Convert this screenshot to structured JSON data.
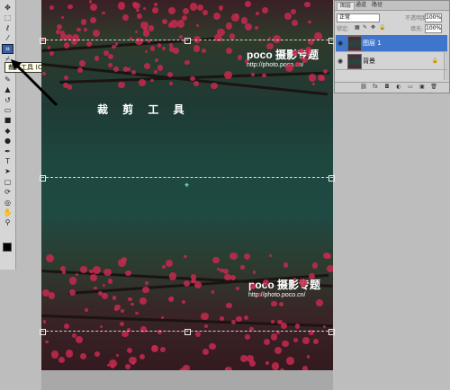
{
  "toolbox": {
    "tools": [
      {
        "icon": "move-tool-icon",
        "glyph": "✥"
      },
      {
        "icon": "marquee-tool-icon",
        "glyph": "⬚"
      },
      {
        "icon": "lasso-tool-icon",
        "glyph": "ℓ"
      },
      {
        "icon": "magic-wand-tool-icon",
        "glyph": "⁄"
      },
      {
        "icon": "crop-tool-icon",
        "glyph": "⌗"
      },
      {
        "icon": "slice-tool-icon",
        "glyph": "⌿"
      },
      {
        "icon": "healing-brush-icon",
        "glyph": "✚"
      },
      {
        "icon": "brush-tool-icon",
        "glyph": "✎"
      },
      {
        "icon": "stamp-tool-icon",
        "glyph": "▲"
      },
      {
        "icon": "history-brush-icon",
        "glyph": "↺"
      },
      {
        "icon": "eraser-tool-icon",
        "glyph": "▭"
      },
      {
        "icon": "gradient-tool-icon",
        "glyph": "■"
      },
      {
        "icon": "blur-tool-icon",
        "glyph": "◆"
      },
      {
        "icon": "dodge-tool-icon",
        "glyph": "●"
      },
      {
        "icon": "pen-tool-icon",
        "glyph": "✒"
      },
      {
        "icon": "type-tool-icon",
        "glyph": "T"
      },
      {
        "icon": "path-selection-icon",
        "glyph": "➤"
      },
      {
        "icon": "shape-tool-icon",
        "glyph": "▢"
      },
      {
        "icon": "3d-rotate-icon",
        "glyph": "⟳"
      },
      {
        "icon": "3d-orbit-icon",
        "glyph": "◎"
      },
      {
        "icon": "hand-tool-icon",
        "glyph": "✋"
      },
      {
        "icon": "zoom-tool-icon",
        "glyph": "⚲"
      }
    ],
    "active_tool": "crop-tool-icon",
    "tooltip": "裁剪工具 (C)"
  },
  "canvas": {
    "annotation": "裁 剪 工 具",
    "watermark_top": {
      "text": "poco 摄影专题",
      "sub": "http://photo.poco.cn/"
    },
    "watermark_bottom": {
      "text": "poco 摄影专题",
      "sub": "http://photo.poco.cn/"
    },
    "center_marker": "⌖"
  },
  "layers_panel": {
    "tabs": [
      "图层",
      "通道",
      "路径"
    ],
    "active_tab": "图层",
    "blend_mode": "正常",
    "opacity_label": "不透明度:",
    "opacity_value": "100%",
    "lock_label": "锁定:",
    "fill_label": "填充:",
    "fill_value": "100%",
    "layers": [
      {
        "name": "图层 1",
        "selected": true,
        "locked": false
      },
      {
        "name": "背景",
        "selected": false,
        "locked": true
      }
    ]
  },
  "colors": {
    "accent": "#3f76cc",
    "blossom": "#c7294f"
  }
}
